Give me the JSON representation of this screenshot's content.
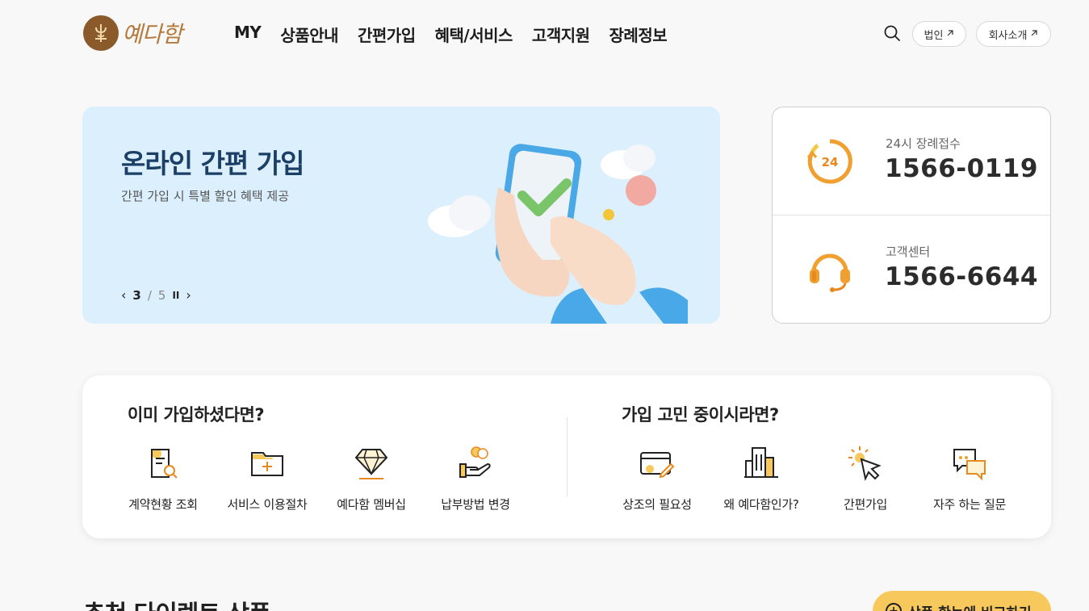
{
  "header": {
    "logo_text": "예다함",
    "nav": [
      "MY",
      "상품안내",
      "간편가입",
      "혜택/서비스",
      "고객지원",
      "장례정보"
    ],
    "corp_label": "법인",
    "about_label": "회사소개",
    "external_icon": "arrow-up-right-icon",
    "search_icon": "search-icon"
  },
  "banner": {
    "title": "온라인 간편 가입",
    "subtitle": "간편 가입 시 특별 할인 혜택 제공",
    "pager": {
      "current": "3",
      "separator": "/",
      "total": "5",
      "pause": "II",
      "prev": "‹",
      "next": "›"
    }
  },
  "contact": {
    "funeral_label": "24시 장례접수",
    "funeral_number": "1566-0119",
    "funeral_icon_text": "24",
    "center_label": "고객센터",
    "center_number": "1566-6644"
  },
  "quick": {
    "left_title": "이미 가입하셨다면?",
    "right_title": "가입 고민 중이시라면?",
    "left_items": [
      {
        "label": "계약현황 조회",
        "icon": "document-search-icon"
      },
      {
        "label": "서비스 이용절차",
        "icon": "folder-plus-icon"
      },
      {
        "label": "예다함 멤버십",
        "icon": "diamond-icon"
      },
      {
        "label": "납부방법 변경",
        "icon": "hand-coins-icon"
      }
    ],
    "right_items": [
      {
        "label": "상조의 필요성",
        "icon": "card-pen-icon"
      },
      {
        "label": "왜 예다함인가?",
        "icon": "building-icon"
      },
      {
        "label": "간편가입",
        "icon": "cursor-click-icon"
      },
      {
        "label": "자주 하는 질문",
        "icon": "chat-bubbles-icon"
      }
    ]
  },
  "recommend": {
    "title": "추천 다이렉트 상품",
    "compare_label": "상품 한눈에 비교하기",
    "compare_icon": "+"
  },
  "colors": {
    "accent": "#f0a030",
    "brand": "#8a5a2b",
    "banner_bg": "#dbeffd",
    "compare_bg": "#f7c95c"
  }
}
